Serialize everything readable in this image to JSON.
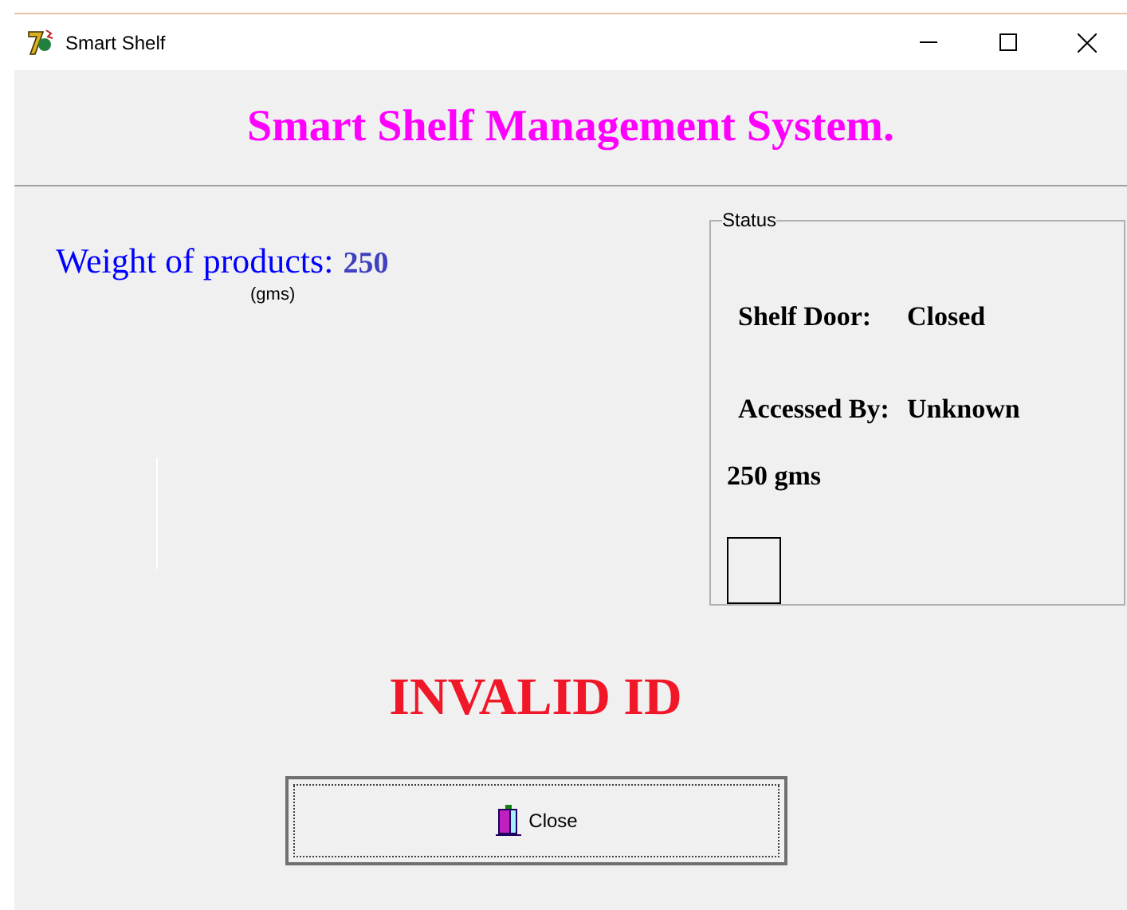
{
  "window": {
    "title": "Smart Shelf"
  },
  "header": {
    "title": "Smart Shelf Management System."
  },
  "weight": {
    "label": "Weight of products:",
    "value": "250",
    "unit": "(gms)"
  },
  "status": {
    "legend": "Status",
    "rows": [
      {
        "label": "Shelf Door:",
        "value": "Closed"
      },
      {
        "label": "Accessed By:",
        "value": "Unknown"
      }
    ],
    "reading": "250 gms"
  },
  "message": "INVALID ID",
  "close_button": {
    "label": "Close",
    "focused": true
  }
}
